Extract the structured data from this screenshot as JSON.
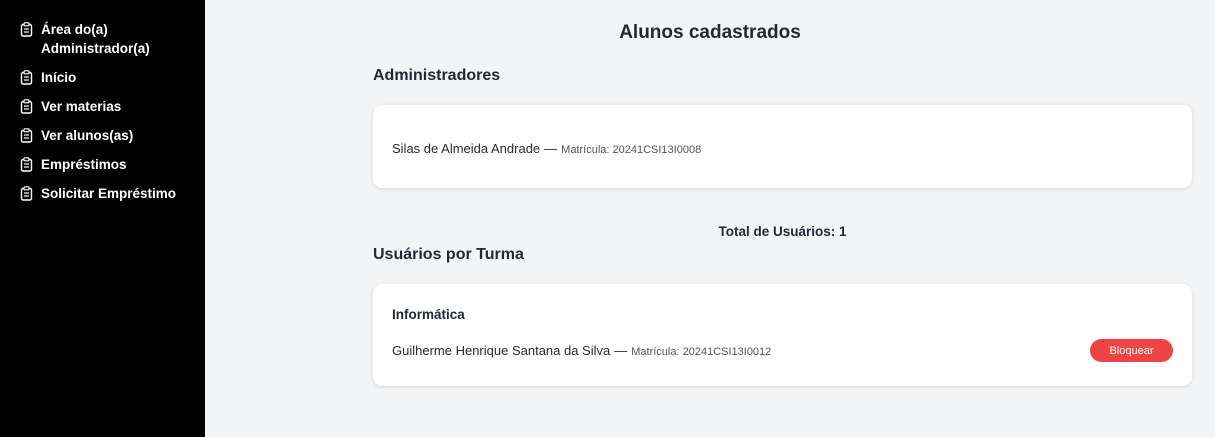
{
  "sidebar": {
    "items": [
      {
        "label": "Área do(a) Administrador(a)",
        "icon": "clipboard-icon"
      },
      {
        "label": "Início",
        "icon": "clipboard-icon"
      },
      {
        "label": "Ver materias",
        "icon": "clipboard-icon"
      },
      {
        "label": "Ver alunos(as)",
        "icon": "clipboard-icon"
      },
      {
        "label": "Empréstimos",
        "icon": "clipboard-icon"
      },
      {
        "label": "Solicitar Empréstimo",
        "icon": "clipboard-icon"
      }
    ]
  },
  "main": {
    "title": "Alunos cadastrados",
    "admins_section": {
      "title": "Administradores",
      "items": [
        {
          "name": "Silas de Almeida Andrade",
          "separator": "—",
          "matricula": "Matrícula: 20241CSI13I0008"
        }
      ]
    },
    "total": "Total de Usuários: 1",
    "turma_section": {
      "title": "Usuários por Turma",
      "groups": [
        {
          "turma": "Informática",
          "students": [
            {
              "name": "Guilherme Henrique Santana da Silva",
              "separator": "—",
              "matricula": "Matrícula: 20241CSI13I0012",
              "action_label": "Bloquear"
            }
          ]
        }
      ]
    }
  },
  "colors": {
    "sidebar_bg": "#000000",
    "page_bg": "#f3f4f6",
    "block_button": "#ef4444"
  }
}
